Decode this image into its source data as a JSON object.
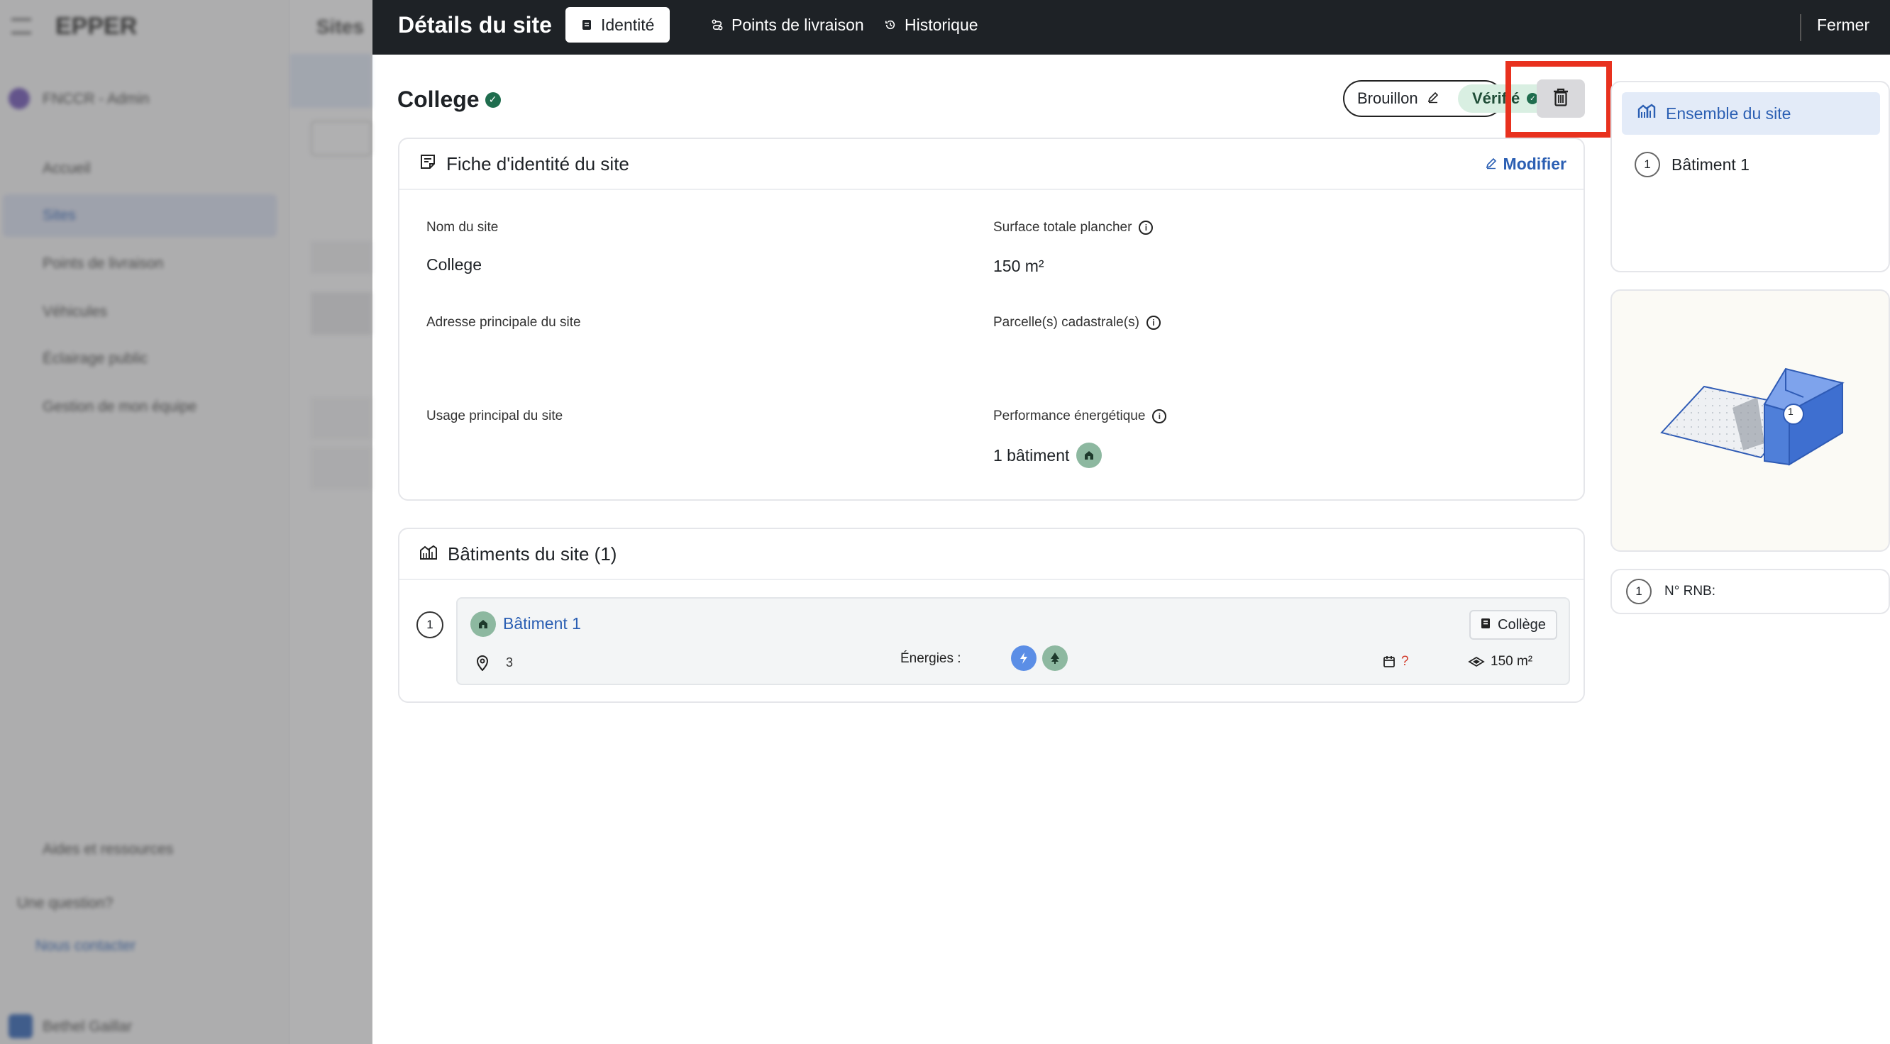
{
  "background_app": {
    "logo": "EPPER",
    "org": "FNCCR - Admin",
    "page_heading": "Sites",
    "nav": [
      "Accueil",
      "Sites",
      "Points de livraison",
      "Véhicules",
      "Éclairage public",
      "Gestion de mon équipe"
    ],
    "help": "Aides et ressources",
    "question": "Une question?",
    "contact": "Nous contacter",
    "user": "Bethel Gaillar"
  },
  "panel": {
    "title": "Détails du site",
    "tabs": [
      {
        "label": "Identité",
        "icon": "document-icon",
        "active": true
      },
      {
        "label": "Points de livraison",
        "icon": "route-icon",
        "active": false
      },
      {
        "label": "Historique",
        "icon": "history-icon",
        "active": false
      }
    ],
    "close_label": "Fermer"
  },
  "site": {
    "name": "College",
    "status_draft": "Brouillon",
    "status_verified": "Vérifié"
  },
  "identity_card": {
    "title": "Fiche d'identité du site",
    "edit_label": "Modifier",
    "fields": {
      "name_label": "Nom du site",
      "name_value": "College",
      "surface_label": "Surface totale plancher",
      "surface_value": "150 m²",
      "address_label": "Adresse principale du site",
      "parcel_label": "Parcelle(s) cadastrale(s)",
      "usage_label": "Usage principal du site",
      "perf_label": "Performance énergétique",
      "perf_value": "1 bâtiment"
    }
  },
  "buildings_card": {
    "title": "Bâtiments du site (1)",
    "buildings": [
      {
        "number": "1",
        "name": "Bâtiment 1",
        "tag": "Collège",
        "address": "3",
        "energies_label": "Énergies :",
        "year": "?",
        "surface": "150 m²"
      }
    ]
  },
  "right_panel": {
    "root_label": "Ensemble du site",
    "child_number": "1",
    "child_label": "Bâtiment 1",
    "map_marker": "1",
    "rnb_number": "1",
    "rnb_label": "N° RNB:"
  },
  "colors": {
    "topbar": "#1e2226",
    "link": "#2b5fb3",
    "verified_bg": "#d9efe2",
    "highlight": "#e8311e",
    "building_3d": "#5b8ee6"
  }
}
